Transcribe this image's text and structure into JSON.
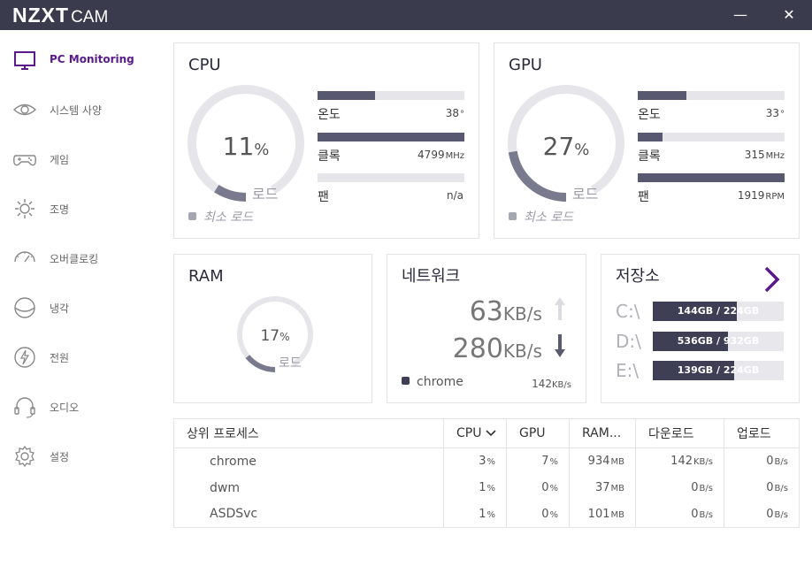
{
  "titlebar": {
    "brand_bold": "NZXT",
    "brand_light": "CAM",
    "minimize_glyph": "—",
    "close_glyph": "✕"
  },
  "sidebar": {
    "items": [
      {
        "label": "PC Monitoring",
        "icon": "monitor-icon",
        "active": true
      },
      {
        "label": "시스템 사양",
        "icon": "eye-icon",
        "active": false
      },
      {
        "label": "게임",
        "icon": "gamepad-icon",
        "active": false
      },
      {
        "label": "조명",
        "icon": "sun-icon",
        "active": false
      },
      {
        "label": "오버클로킹",
        "icon": "speedometer-icon",
        "active": false
      },
      {
        "label": "냉각",
        "icon": "fan-icon",
        "active": false
      },
      {
        "label": "전원",
        "icon": "lightning-icon",
        "active": false
      },
      {
        "label": "오디오",
        "icon": "headset-icon",
        "active": false
      },
      {
        "label": "설정",
        "icon": "gear-icon",
        "active": false
      }
    ]
  },
  "cpu": {
    "title": "CPU",
    "load_value": "11",
    "load_unit": "%",
    "load_fraction": 0.11,
    "load_label": "로드",
    "min_load_label": "최소 로드",
    "stats": [
      {
        "name": "온도",
        "value": "38",
        "unit": "°",
        "fraction": 0.39
      },
      {
        "name": "클록",
        "value": "4799",
        "unit": "MHz",
        "fraction": 1.0
      },
      {
        "name": "팬",
        "value": "n/a",
        "unit": "",
        "fraction": 0.0
      }
    ]
  },
  "gpu": {
    "title": "GPU",
    "load_value": "27",
    "load_unit": "%",
    "load_fraction": 0.27,
    "load_label": "로드",
    "min_load_label": "최소 로드",
    "stats": [
      {
        "name": "온도",
        "value": "33",
        "unit": "°",
        "fraction": 0.33
      },
      {
        "name": "클록",
        "value": "315",
        "unit": "MHz",
        "fraction": 0.17
      },
      {
        "name": "팬",
        "value": "1919",
        "unit": "RPM",
        "fraction": 1.0
      }
    ]
  },
  "ram": {
    "title": "RAM",
    "load_value": "17",
    "load_unit": "%",
    "load_fraction": 0.17,
    "load_label": "로드"
  },
  "network": {
    "title": "네트워크",
    "upload_value": "63",
    "upload_unit": "KB/s",
    "download_value": "280",
    "download_unit": "KB/s",
    "top_app": "chrome",
    "top_app_value": "142",
    "top_app_unit": "KB/s"
  },
  "storage": {
    "title": "저장소",
    "drives": [
      {
        "letter": "C:\\",
        "text": "144GB / 224GB",
        "fraction": 0.643
      },
      {
        "letter": "D:\\",
        "text": "536GB / 932GB",
        "fraction": 0.575
      },
      {
        "letter": "E:\\",
        "text": "139GB / 224GB",
        "fraction": 0.62
      }
    ]
  },
  "processes": {
    "columns": [
      "상위 프로세스",
      "CPU",
      "GPU",
      "RAM...",
      "다운로드",
      "업로드"
    ],
    "rows": [
      {
        "name": "chrome",
        "cpu": "3",
        "cpu_unit": "%",
        "gpu": "7",
        "gpu_unit": "%",
        "ram": "934",
        "ram_unit": "MB",
        "down": "142",
        "down_unit": "KB/s",
        "up": "0",
        "up_unit": "B/s"
      },
      {
        "name": "dwm",
        "cpu": "1",
        "cpu_unit": "%",
        "gpu": "0",
        "gpu_unit": "%",
        "ram": "37",
        "ram_unit": "MB",
        "down": "0",
        "down_unit": "B/s",
        "up": "0",
        "up_unit": "B/s"
      },
      {
        "name": "ASDSvc",
        "cpu": "1",
        "cpu_unit": "%",
        "gpu": "0",
        "gpu_unit": "%",
        "ram": "101",
        "ram_unit": "MB",
        "down": "0",
        "down_unit": "B/s",
        "up": "0",
        "up_unit": "B/s"
      }
    ]
  },
  "colors": {
    "titlebar": "#3b3b4e",
    "accent": "#5a1a8a",
    "bar_fill": "#585870",
    "track": "#e6e6ea"
  }
}
